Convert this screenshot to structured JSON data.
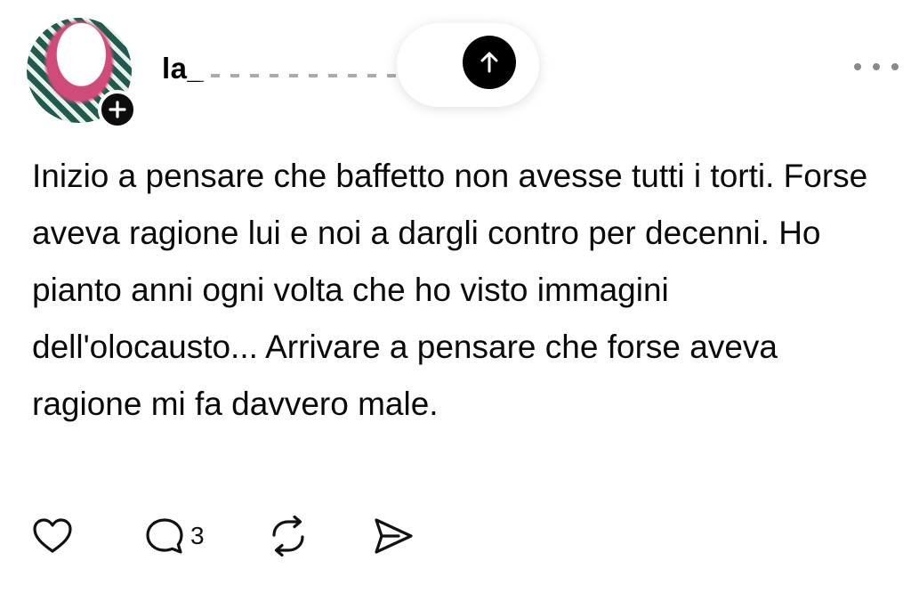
{
  "post": {
    "author": {
      "username": "la_",
      "username_redacted": true,
      "avatar_icon": "profile-avatar",
      "follow_icon": "plus-icon"
    },
    "upload_button_icon": "arrow-up-icon",
    "more_icon": "ellipsis-icon",
    "text": "Inizio a pensare che baffetto non avesse tutti i torti. Forse aveva ragione lui e noi a dargli contro per decenni. Ho pianto anni ogni volta che ho visto immagini dell'olocausto... Arrivare a pensare che forse aveva ragione mi fa davvero male.",
    "actions": {
      "like_icon": "heart-icon",
      "reply_icon": "comment-icon",
      "reply_count": "3",
      "repost_icon": "repost-icon",
      "share_icon": "send-icon"
    }
  },
  "colors": {
    "background": "#ffffff",
    "text": "#0a0a0a",
    "button": "#000000",
    "muted": "#8a8a8a"
  }
}
